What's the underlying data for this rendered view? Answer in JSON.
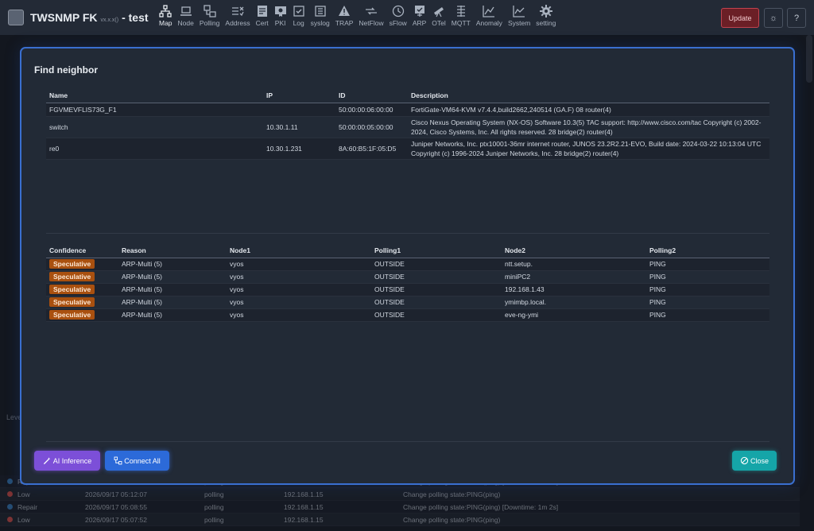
{
  "app": {
    "title": "TWSNMP FK",
    "version": "vx.x.x()",
    "suffix": "- test"
  },
  "nav": [
    {
      "label": "Map",
      "icon": "map-icon",
      "active": true
    },
    {
      "label": "Node",
      "icon": "laptop-icon"
    },
    {
      "label": "Polling",
      "icon": "polling-icon"
    },
    {
      "label": "Address",
      "icon": "address-icon"
    },
    {
      "label": "Cert",
      "icon": "cert-icon"
    },
    {
      "label": "PKI",
      "icon": "pki-icon"
    },
    {
      "label": "Log",
      "icon": "log-icon"
    },
    {
      "label": "syslog",
      "icon": "syslog-icon"
    },
    {
      "label": "TRAP",
      "icon": "trap-warning-icon"
    },
    {
      "label": "NetFlow",
      "icon": "netflow-icon"
    },
    {
      "label": "sFlow",
      "icon": "sflow-clock-icon"
    },
    {
      "label": "ARP",
      "icon": "arp-icon"
    },
    {
      "label": "OTel",
      "icon": "telescope-icon"
    },
    {
      "label": "MQTT",
      "icon": "mqtt-icon"
    },
    {
      "label": "Anomaly",
      "icon": "chart-line-icon"
    },
    {
      "label": "System",
      "icon": "system-chart-icon"
    },
    {
      "label": "setting",
      "icon": "gear-icon"
    }
  ],
  "header_buttons": {
    "update": "Update",
    "theme_icon": "sun-icon",
    "help": "?"
  },
  "modal": {
    "title": "Find neighbor",
    "neighbor_columns": [
      "Name",
      "IP",
      "ID",
      "Description"
    ],
    "neighbors": [
      {
        "name": "FGVMEVFLIS73G_F1",
        "ip": "",
        "id": "50:00:00:06:00:00",
        "description": "FortiGate-VM64-KVM v7.4.4,build2662,240514 (GA.F) 08 router(4)"
      },
      {
        "name": "switch",
        "ip": "10.30.1.11",
        "id": "50:00:00:05:00:00",
        "description": "Cisco Nexus Operating System (NX-OS) Software 10.3(5) TAC support: http://www.cisco.com/tac Copyright (c) 2002-2024, Cisco Systems, Inc. All rights reserved. 28 bridge(2) router(4)"
      },
      {
        "name": "re0",
        "ip": "10.30.1.231",
        "id": "8A:60:B5:1F:05:D5",
        "description": "Juniper Networks, Inc. ptx10001-36mr internet router, JUNOS 23.2R2.21-EVO, Build date: 2024-03-22 10:13:04 UTC Copyright (c) 1996-2024 Juniper Networks, Inc. 28 bridge(2) router(4)"
      }
    ],
    "edge_columns": [
      "Confidence",
      "Reason",
      "Node1",
      "Polling1",
      "Node2",
      "Polling2"
    ],
    "edges": [
      {
        "confidence": "Speculative",
        "reason": "ARP-Multi (5)",
        "node1": "vyos",
        "polling1": "OUTSIDE",
        "node2": "ntt.setup.",
        "polling2": "PING"
      },
      {
        "confidence": "Speculative",
        "reason": "ARP-Multi (5)",
        "node1": "vyos",
        "polling1": "OUTSIDE",
        "node2": "miniPC2",
        "polling2": "PING"
      },
      {
        "confidence": "Speculative",
        "reason": "ARP-Multi (5)",
        "node1": "vyos",
        "polling1": "OUTSIDE",
        "node2": "192.168.1.43",
        "polling2": "PING"
      },
      {
        "confidence": "Speculative",
        "reason": "ARP-Multi (5)",
        "node1": "vyos",
        "polling1": "OUTSIDE",
        "node2": "ymimbp.local.",
        "polling2": "PING"
      },
      {
        "confidence": "Speculative",
        "reason": "ARP-Multi (5)",
        "node1": "vyos",
        "polling1": "OUTSIDE",
        "node2": "eve-ng-ymi",
        "polling2": "PING"
      }
    ],
    "buttons": {
      "ai": "AI Inference",
      "connect": "Connect All",
      "close": "Close"
    }
  },
  "log": {
    "header": "Leve",
    "rows": [
      {
        "level": "Repair",
        "time": "2026/09/17 05:13:09",
        "type": "polling",
        "ip": "192.168.1.15",
        "message": "Change polling state:PING(ping) [Downtime: 1m 2s]",
        "color": "#3b82c4"
      },
      {
        "level": "Low",
        "time": "2026/09/17 05:12:07",
        "type": "polling",
        "ip": "192.168.1.15",
        "message": "Change polling state:PING(ping)",
        "color": "#d9534f"
      },
      {
        "level": "Repair",
        "time": "2026/09/17 05:08:55",
        "type": "polling",
        "ip": "192.168.1.15",
        "message": "Change polling state:PING(ping) [Downtime: 1m 2s]",
        "color": "#3b82c4"
      },
      {
        "level": "Low",
        "time": "2026/09/17 05:07:52",
        "type": "polling",
        "ip": "192.168.1.15",
        "message": "Change polling state:PING(ping)",
        "color": "#d9534f"
      }
    ]
  }
}
